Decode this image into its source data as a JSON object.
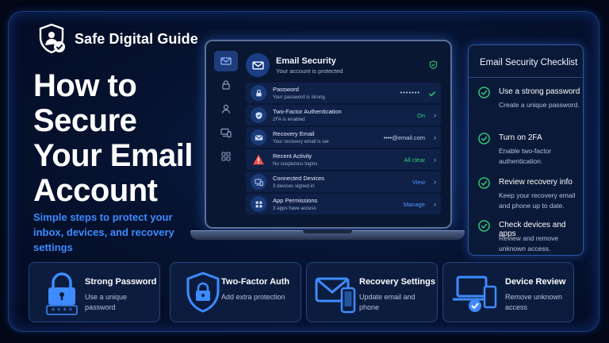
{
  "brand": {
    "name": "Safe Digital Guide",
    "logo_icon": "shield-user-check-icon"
  },
  "headline": {
    "lines": [
      "How to",
      "Secure",
      "Your Email",
      "Account"
    ]
  },
  "subtitle": "Simple steps to protect your inbox, devices, and recovery settings",
  "app": {
    "sidebar": [
      {
        "icon": "mail-icon",
        "active": true
      },
      {
        "icon": "lock-icon",
        "active": false
      },
      {
        "icon": "user-icon",
        "active": false
      },
      {
        "icon": "devices-icon",
        "active": false
      },
      {
        "icon": "grid-icon",
        "active": false
      }
    ],
    "header": {
      "title": "Email Security",
      "subtitle": "Your account is protected"
    },
    "rows": [
      {
        "icon": "lock-icon",
        "title": "Password",
        "subtitle": "Your password is strong",
        "value": "•••••••"
      },
      {
        "icon": "shield-check-icon",
        "title": "Two-Factor Authentication",
        "subtitle": "2FA is enabled",
        "value": "On"
      },
      {
        "icon": "mail-icon",
        "title": "Recovery Email",
        "subtitle": "Your recovery email is set",
        "value": "••••@email.com"
      },
      {
        "icon": "warning-icon",
        "title": "Recent Activity",
        "subtitle": "No suspicious logins",
        "value": "All clear"
      },
      {
        "icon": "devices-icon",
        "title": "Connected Devices",
        "subtitle": "3 devices signed in",
        "value": "View"
      },
      {
        "icon": "grid-icon",
        "title": "App Permissions",
        "subtitle": "3 apps have access",
        "value": "Manage"
      }
    ]
  },
  "checklist": {
    "title": "Email Security Checklist",
    "items": [
      {
        "title": "Use a strong password",
        "desc": "Create a unique password."
      },
      {
        "title": "Turn on 2FA",
        "desc": "Enable two-factor authentication."
      },
      {
        "title": "Review recovery info",
        "desc": "Keep your recovery email and phone up to date."
      },
      {
        "title": "Check devices and apps",
        "desc": "Review and remove unknown access."
      }
    ]
  },
  "cards": [
    {
      "icon": "padlock-password-icon",
      "title": "Strong Password",
      "desc": "Use a unique password"
    },
    {
      "icon": "shield-lock-icon",
      "title": "Two-Factor Auth",
      "desc": "Add extra protection"
    },
    {
      "icon": "envelope-phone-icon",
      "title": "Recovery Settings",
      "desc": "Update email and phone"
    },
    {
      "icon": "laptop-phone-check-icon",
      "title": "Device Review",
      "desc": "Remove unknown access"
    }
  ],
  "colors": {
    "accent": "#3e8bff",
    "success": "#32d17a",
    "warning": "#ff4d4d",
    "background": "#061331"
  }
}
